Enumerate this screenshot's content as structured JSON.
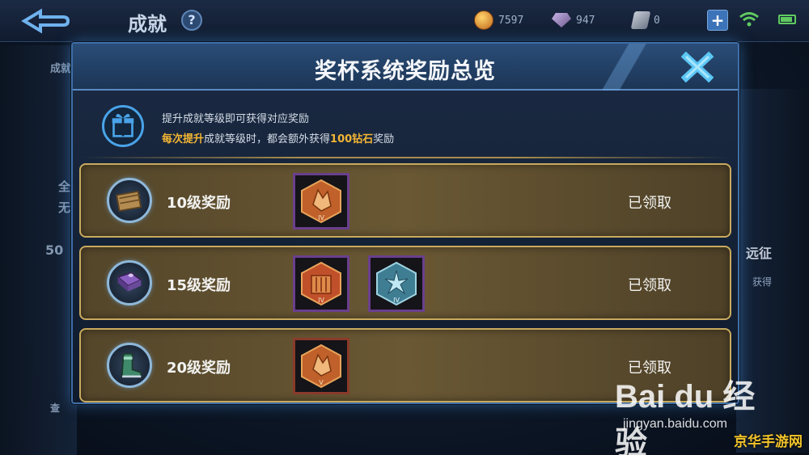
{
  "background": {
    "page_title": "成就",
    "help_label": "?",
    "currency": {
      "gold": "7597",
      "diamonds": "947",
      "tickets": "0"
    },
    "plus_label": "+",
    "partial_texts": {
      "left_top": "成就",
      "left_mid": "全",
      "left_mid2": "无",
      "left_count": "50",
      "left_btn": "查",
      "right_expedition": "远征",
      "right_obtain": "获得"
    }
  },
  "modal": {
    "title": "奖杯系统奖励总览",
    "info": {
      "line1": "提升成就等级即可获得对应奖励",
      "line2_hl1": "每次提升",
      "line2_mid": "成就等级时，都会额外获得",
      "line2_hl2": "100钻石",
      "line2_end": "奖励"
    },
    "rows": [
      {
        "label": "10级奖励",
        "status": "已领取",
        "icon": "wooden-box-icon",
        "items": [
          "inscription-fragment-orange-iv"
        ]
      },
      {
        "label": "15级奖励",
        "status": "已领取",
        "icon": "purple-book-icon",
        "items": [
          "inscription-orange-iv",
          "inscription-blue-iv"
        ]
      },
      {
        "label": "20级奖励",
        "status": "已领取",
        "icon": "boot-icon",
        "items": [
          "inscription-fragment-orange-v"
        ]
      }
    ],
    "item_marks": {
      "iv": "IV",
      "v": "V"
    }
  },
  "watermarks": {
    "baidu": "Bai du 经验",
    "url": "jingyan.baidu.com",
    "corner": "京华手游网"
  },
  "colors": {
    "accent_gold": "#c9aa5e",
    "highlight": "#f2b533",
    "frame_blue": "#3f6ea6"
  }
}
